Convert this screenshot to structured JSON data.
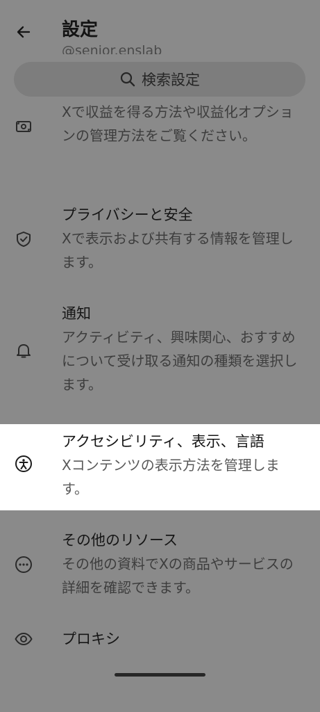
{
  "header": {
    "title": "設定",
    "handle": "@senior.enslab"
  },
  "search": {
    "placeholder": "検索設定"
  },
  "items": [
    {
      "id": "monetization",
      "title": "",
      "description": "Xで収益を得る方法や収益化オプションの管理方法をご覧ください。",
      "icon": "money-icon"
    },
    {
      "id": "privacy",
      "title": "プライバシーと安全",
      "description": "Xで表示および共有する情報を管理します。",
      "icon": "shield-check-icon"
    },
    {
      "id": "notifications",
      "title": "通知",
      "description": "アクティビティ、興味関心、おすすめについて受け取る通知の種類を選択します。",
      "icon": "bell-icon"
    },
    {
      "id": "accessibility",
      "title": "アクセシビリティ、表示、言語",
      "description": "Xコンテンツの表示方法を管理します。",
      "icon": "accessibility-icon",
      "highlighted": true
    },
    {
      "id": "resources",
      "title": "その他のリソース",
      "description": "その他の資料でXの商品やサービスの詳細を確認できます。",
      "icon": "more-horizontal-icon"
    },
    {
      "id": "proxy",
      "title": "プロキシ",
      "description": "",
      "icon": "eye-icon"
    }
  ],
  "colors": {
    "overlay": "#8a8a8a",
    "highlight": "#ffffff"
  }
}
